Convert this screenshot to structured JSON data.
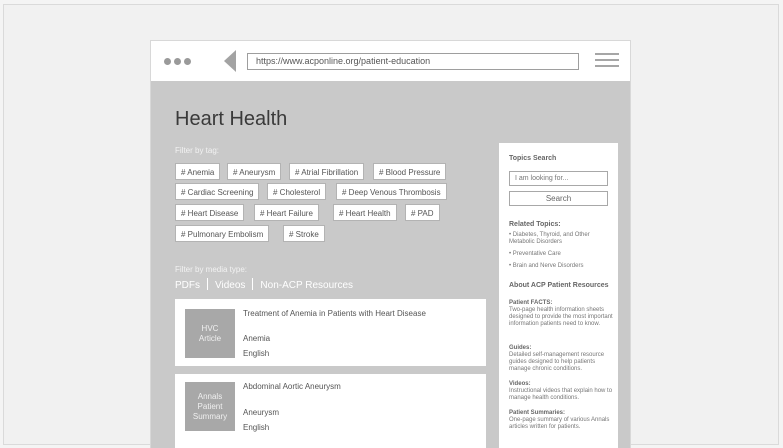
{
  "browser": {
    "url": "https://www.acponline.org/patient-education"
  },
  "page": {
    "title": "Heart Health",
    "filter_tag_label": "Filter by tag:",
    "tags": [
      "# Anemia",
      "# Aneurysm",
      "# Atrial Fibrillation",
      "# Blood Pressure",
      "# Cardiac Screening",
      "# Cholesterol",
      "# Deep Venous Thrombosis",
      "# Heart Disease",
      "# Heart Failure",
      "# Heart Health",
      "# PAD",
      "# Pulmonary Embolism",
      "# Stroke"
    ],
    "filter_media_label": "Filter by media type:",
    "media_types": [
      "PDFs",
      "Videos",
      "Non-ACP Resources"
    ]
  },
  "results": [
    {
      "thumb": "HVC\nArticle",
      "title": "Treatment of Anemia in Patients with Heart Disease",
      "tag": "Anemia",
      "language": "English"
    },
    {
      "thumb": "Annals\nPatient\nSummary",
      "title": "Abdominal Aortic Aneurysm",
      "tag": "Aneurysm",
      "language": "English"
    }
  ],
  "sidebar": {
    "search_heading": "Topics Search",
    "search_placeholder": "I am looking for...",
    "search_button": "Search",
    "related_heading": "Related Topics:",
    "related_items": [
      "• Diabetes, Thyroid, and Other Metabolic Disorders",
      "• Preventative Care",
      "• Brain and Nerve Disorders"
    ],
    "about_heading": "About ACP Patient Resources",
    "resources": [
      {
        "label": "Patient FACTS:",
        "desc": "Two-page health information sheets designed to provide the most important information patients need to know."
      },
      {
        "label": "Guides:",
        "desc": "Detailed self-management resource guides designed to help patients manage chronic conditions."
      },
      {
        "label": "Videos:",
        "desc": "Instructional videos that explain how to manage health conditions."
      },
      {
        "label": "Patient Summaries:",
        "desc": "One-page summary of various Annals articles written for patients."
      }
    ]
  }
}
